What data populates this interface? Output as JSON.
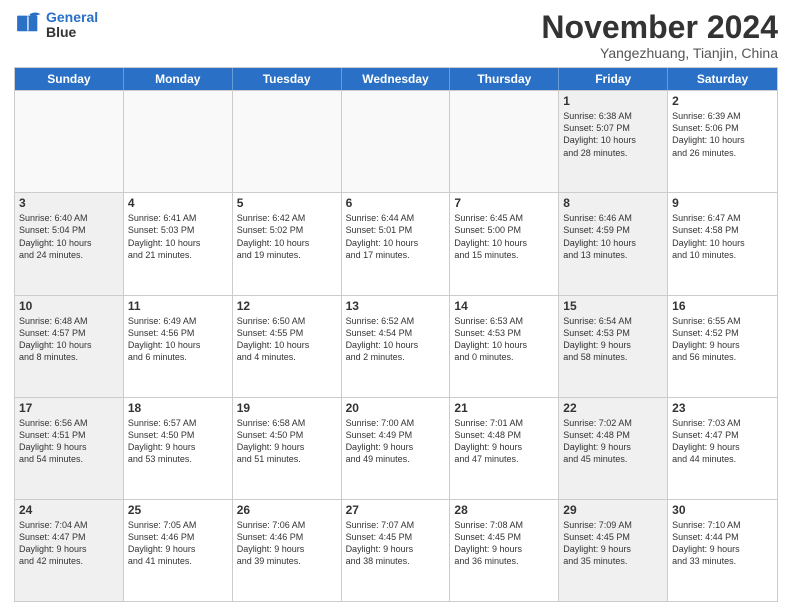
{
  "header": {
    "logo_line1": "General",
    "logo_line2": "Blue",
    "month": "November 2024",
    "location": "Yangezhuang, Tianjin, China"
  },
  "weekdays": [
    "Sunday",
    "Monday",
    "Tuesday",
    "Wednesday",
    "Thursday",
    "Friday",
    "Saturday"
  ],
  "rows": [
    [
      {
        "day": "",
        "text": "",
        "empty": true
      },
      {
        "day": "",
        "text": "",
        "empty": true
      },
      {
        "day": "",
        "text": "",
        "empty": true
      },
      {
        "day": "",
        "text": "",
        "empty": true
      },
      {
        "day": "",
        "text": "",
        "empty": true
      },
      {
        "day": "1",
        "text": "Sunrise: 6:38 AM\nSunset: 5:07 PM\nDaylight: 10 hours\nand 28 minutes.",
        "shaded": true
      },
      {
        "day": "2",
        "text": "Sunrise: 6:39 AM\nSunset: 5:06 PM\nDaylight: 10 hours\nand 26 minutes."
      }
    ],
    [
      {
        "day": "3",
        "text": "Sunrise: 6:40 AM\nSunset: 5:04 PM\nDaylight: 10 hours\nand 24 minutes.",
        "shaded": true
      },
      {
        "day": "4",
        "text": "Sunrise: 6:41 AM\nSunset: 5:03 PM\nDaylight: 10 hours\nand 21 minutes."
      },
      {
        "day": "5",
        "text": "Sunrise: 6:42 AM\nSunset: 5:02 PM\nDaylight: 10 hours\nand 19 minutes."
      },
      {
        "day": "6",
        "text": "Sunrise: 6:44 AM\nSunset: 5:01 PM\nDaylight: 10 hours\nand 17 minutes."
      },
      {
        "day": "7",
        "text": "Sunrise: 6:45 AM\nSunset: 5:00 PM\nDaylight: 10 hours\nand 15 minutes."
      },
      {
        "day": "8",
        "text": "Sunrise: 6:46 AM\nSunset: 4:59 PM\nDaylight: 10 hours\nand 13 minutes.",
        "shaded": true
      },
      {
        "day": "9",
        "text": "Sunrise: 6:47 AM\nSunset: 4:58 PM\nDaylight: 10 hours\nand 10 minutes."
      }
    ],
    [
      {
        "day": "10",
        "text": "Sunrise: 6:48 AM\nSunset: 4:57 PM\nDaylight: 10 hours\nand 8 minutes.",
        "shaded": true
      },
      {
        "day": "11",
        "text": "Sunrise: 6:49 AM\nSunset: 4:56 PM\nDaylight: 10 hours\nand 6 minutes."
      },
      {
        "day": "12",
        "text": "Sunrise: 6:50 AM\nSunset: 4:55 PM\nDaylight: 10 hours\nand 4 minutes."
      },
      {
        "day": "13",
        "text": "Sunrise: 6:52 AM\nSunset: 4:54 PM\nDaylight: 10 hours\nand 2 minutes."
      },
      {
        "day": "14",
        "text": "Sunrise: 6:53 AM\nSunset: 4:53 PM\nDaylight: 10 hours\nand 0 minutes."
      },
      {
        "day": "15",
        "text": "Sunrise: 6:54 AM\nSunset: 4:53 PM\nDaylight: 9 hours\nand 58 minutes.",
        "shaded": true
      },
      {
        "day": "16",
        "text": "Sunrise: 6:55 AM\nSunset: 4:52 PM\nDaylight: 9 hours\nand 56 minutes."
      }
    ],
    [
      {
        "day": "17",
        "text": "Sunrise: 6:56 AM\nSunset: 4:51 PM\nDaylight: 9 hours\nand 54 minutes.",
        "shaded": true
      },
      {
        "day": "18",
        "text": "Sunrise: 6:57 AM\nSunset: 4:50 PM\nDaylight: 9 hours\nand 53 minutes."
      },
      {
        "day": "19",
        "text": "Sunrise: 6:58 AM\nSunset: 4:50 PM\nDaylight: 9 hours\nand 51 minutes."
      },
      {
        "day": "20",
        "text": "Sunrise: 7:00 AM\nSunset: 4:49 PM\nDaylight: 9 hours\nand 49 minutes."
      },
      {
        "day": "21",
        "text": "Sunrise: 7:01 AM\nSunset: 4:48 PM\nDaylight: 9 hours\nand 47 minutes."
      },
      {
        "day": "22",
        "text": "Sunrise: 7:02 AM\nSunset: 4:48 PM\nDaylight: 9 hours\nand 45 minutes.",
        "shaded": true
      },
      {
        "day": "23",
        "text": "Sunrise: 7:03 AM\nSunset: 4:47 PM\nDaylight: 9 hours\nand 44 minutes."
      }
    ],
    [
      {
        "day": "24",
        "text": "Sunrise: 7:04 AM\nSunset: 4:47 PM\nDaylight: 9 hours\nand 42 minutes.",
        "shaded": true
      },
      {
        "day": "25",
        "text": "Sunrise: 7:05 AM\nSunset: 4:46 PM\nDaylight: 9 hours\nand 41 minutes."
      },
      {
        "day": "26",
        "text": "Sunrise: 7:06 AM\nSunset: 4:46 PM\nDaylight: 9 hours\nand 39 minutes."
      },
      {
        "day": "27",
        "text": "Sunrise: 7:07 AM\nSunset: 4:45 PM\nDaylight: 9 hours\nand 38 minutes."
      },
      {
        "day": "28",
        "text": "Sunrise: 7:08 AM\nSunset: 4:45 PM\nDaylight: 9 hours\nand 36 minutes."
      },
      {
        "day": "29",
        "text": "Sunrise: 7:09 AM\nSunset: 4:45 PM\nDaylight: 9 hours\nand 35 minutes.",
        "shaded": true
      },
      {
        "day": "30",
        "text": "Sunrise: 7:10 AM\nSunset: 4:44 PM\nDaylight: 9 hours\nand 33 minutes."
      }
    ]
  ]
}
